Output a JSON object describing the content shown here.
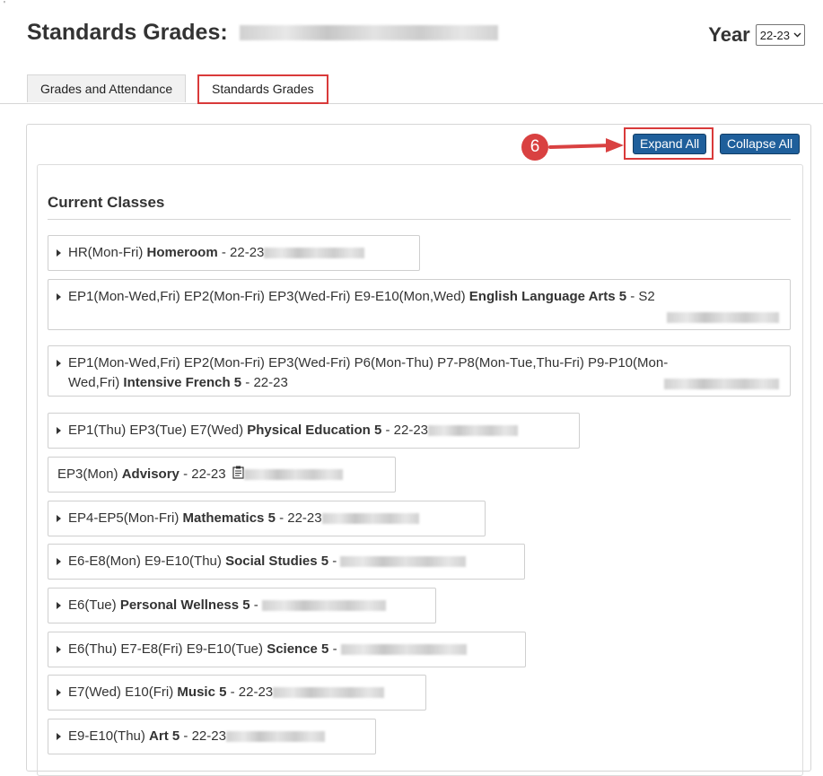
{
  "page": {
    "title_prefix": "Standards Grades:",
    "year_label": "Year",
    "year_value": "22-23",
    "corner_mark": "'"
  },
  "tabs": [
    {
      "label": "Grades and Attendance",
      "active": false
    },
    {
      "label": "Standards Grades",
      "active": true
    }
  ],
  "annotation": {
    "step_number": "6"
  },
  "toolbar": {
    "expand_label": "Expand All",
    "collapse_label": "Collapse All"
  },
  "section": {
    "title": "Current Classes"
  },
  "classes": [
    {
      "schedule": "HR(Mon-Fri)",
      "name": "Homeroom",
      "term": "- 22-23"
    },
    {
      "schedule": "EP1(Mon-Wed,Fri) EP2(Mon-Fri) EP3(Wed-Fri) E9-E10(Mon,Wed)",
      "name": "English Language Arts 5",
      "term": "- S2"
    },
    {
      "schedule": "EP1(Mon-Wed,Fri) EP2(Mon-Fri) EP3(Wed-Fri) P6(Mon-Thu) P7-P8(Mon-Tue,Thu-Fri) P9-P10(Mon-",
      "schedule_cont": "Wed,Fri)",
      "name": "Intensive French 5",
      "term": "- 22-23"
    },
    {
      "schedule": "EP1(Thu) EP3(Tue) E7(Wed)",
      "name": "Physical Education 5",
      "term": "- 22-23"
    },
    {
      "schedule": "EP3(Mon)",
      "name": "Advisory",
      "term": "- 22-23"
    },
    {
      "schedule": "EP4-EP5(Mon-Fri)",
      "name": "Mathematics 5",
      "term": "- 22-23"
    },
    {
      "schedule": "E6-E8(Mon) E9-E10(Thu)",
      "name": "Social Studies 5",
      "term": "-"
    },
    {
      "schedule": "E6(Tue)",
      "name": "Personal Wellness 5",
      "term": "-"
    },
    {
      "schedule": "E6(Thu) E7-E8(Fri) E9-E10(Tue)",
      "name": "Science 5",
      "term": "-"
    },
    {
      "schedule": "E7(Wed) E10(Fri)",
      "name": "Music 5",
      "term": "- 22-23"
    },
    {
      "schedule": "E9-E10(Thu)",
      "name": "Art 5",
      "term": "- 22-23"
    }
  ],
  "colors": {
    "button_bg": "#1f5f9b",
    "highlight": "#d93a3a",
    "annotation": "#d94141"
  },
  "icons": {
    "expand_arrow": "triangle-right",
    "note": "note-icon"
  }
}
